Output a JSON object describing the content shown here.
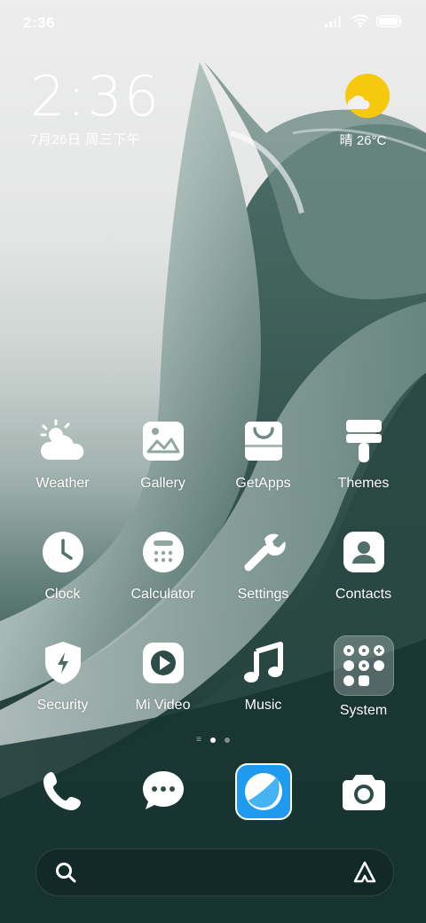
{
  "status_bar": {
    "time": "2:36"
  },
  "clock_widget": {
    "time": "2:36",
    "date": "7月26日 周三下午"
  },
  "weather_widget": {
    "text": "晴 26°C"
  },
  "apps": [
    {
      "label": "Weather",
      "icon": "weather-icon"
    },
    {
      "label": "Gallery",
      "icon": "gallery-icon"
    },
    {
      "label": "GetApps",
      "icon": "getapps-icon"
    },
    {
      "label": "Themes",
      "icon": "themes-icon"
    },
    {
      "label": "Clock",
      "icon": "clock-icon"
    },
    {
      "label": "Calculator",
      "icon": "calculator-icon"
    },
    {
      "label": "Settings",
      "icon": "settings-icon"
    },
    {
      "label": "Contacts",
      "icon": "contacts-icon"
    },
    {
      "label": "Security",
      "icon": "security-icon"
    },
    {
      "label": "Mi Video",
      "icon": "mi-video-icon"
    },
    {
      "label": "Music",
      "icon": "music-icon"
    },
    {
      "label": "System",
      "icon": "system-folder-icon"
    }
  ],
  "dock": [
    {
      "icon": "phone-icon"
    },
    {
      "icon": "messages-icon"
    },
    {
      "icon": "browser-icon"
    },
    {
      "icon": "camera-icon"
    }
  ],
  "colors": {
    "weather_sun": "#f6c90e",
    "browser_blue": "#1e9bf0",
    "folder_bg": "rgba(255,255,255,0.25)"
  }
}
